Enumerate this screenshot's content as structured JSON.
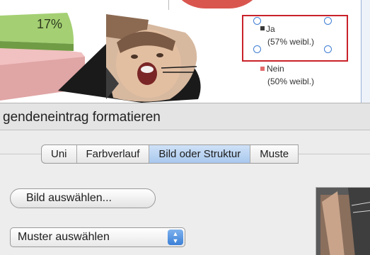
{
  "chart_data": {
    "type": "pie",
    "data_labels": [
      "17%"
    ],
    "legend": [
      {
        "label": "Ja",
        "sublabel": "(57% weibl.)",
        "selected": true,
        "color": "#3a3a3a"
      },
      {
        "label": "Nein",
        "sublabel": "(50% weibl.)",
        "selected": false,
        "color": "#e36b6b"
      }
    ],
    "slice_colors": [
      "#d9564f",
      "#9bc96a"
    ],
    "legend_placement": "right"
  },
  "dialog": {
    "title": "gendeneintrag formatieren",
    "tabs": [
      {
        "label": "Uni",
        "active": false
      },
      {
        "label": "Farbverlauf",
        "active": false
      },
      {
        "label": "Bild oder Struktur",
        "active": true
      },
      {
        "label": "Muste",
        "active": false
      }
    ],
    "choose_picture_button": "Bild auswählen...",
    "pattern_select": {
      "value": "Muster auswählen"
    }
  },
  "colors": {
    "selection": "#c9222a",
    "handle": "#3f7ed3",
    "active_tab": "#b9d3f2"
  }
}
